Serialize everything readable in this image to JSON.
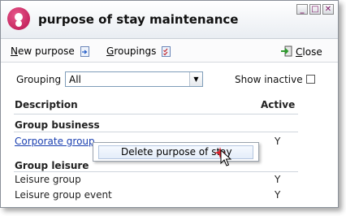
{
  "window": {
    "title": "purpose of stay maintenance"
  },
  "titlebar_buttons": [
    {
      "name": "minimize",
      "glyph": "_"
    },
    {
      "name": "maximize",
      "glyph": "□"
    },
    {
      "name": "close",
      "glyph": "✕"
    }
  ],
  "toolbar": {
    "new_purpose_underline": "N",
    "new_purpose_rest": "ew purpose",
    "groupings_underline": "G",
    "groupings_rest": "roupings",
    "close_underline": "C",
    "close_rest": "lose"
  },
  "filters": {
    "grouping_label": "Grouping",
    "grouping_value": "All",
    "show_inactive_label": "Show inactive",
    "show_inactive_checked": false
  },
  "table": {
    "headers": {
      "description": "Description",
      "active": "Active"
    },
    "groups": [
      {
        "name": "Group business",
        "rows": [
          {
            "description": "Corporate group",
            "active": "Y"
          }
        ]
      },
      {
        "name": "Group leisure",
        "rows": [
          {
            "description": "Leisure group",
            "active": "Y"
          },
          {
            "description": "Leisure group event",
            "active": "Y"
          }
        ]
      }
    ]
  },
  "context_menu": {
    "items": [
      {
        "label": "Delete purpose of stay"
      }
    ]
  },
  "icons": [
    "app-logo-icon",
    "document-arrow-icon",
    "checklist-icon",
    "exit-door-icon",
    "delete-star-icon",
    "mouse-pointer-icon"
  ]
}
